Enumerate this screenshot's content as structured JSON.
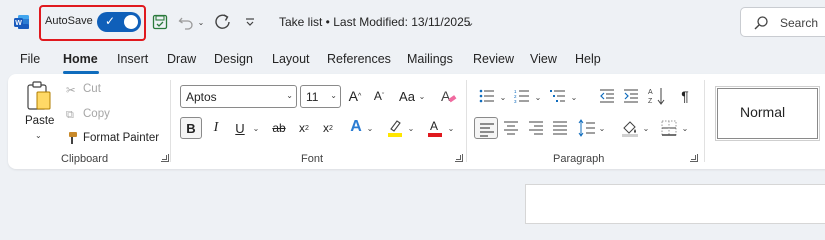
{
  "titlebar": {
    "autosave_label": "AutoSave",
    "autosave_on": true,
    "doc_title": "Take list • Last Modified: 13/11/2025",
    "search_label": "Search"
  },
  "tabs": [
    "File",
    "Home",
    "Insert",
    "Draw",
    "Design",
    "Layout",
    "References",
    "Mailings",
    "Review",
    "View",
    "Help"
  ],
  "active_tab": "Home",
  "clipboard": {
    "paste": "Paste",
    "cut": "Cut",
    "copy": "Copy",
    "format_painter": "Format Painter",
    "group_label": "Clipboard"
  },
  "font": {
    "font_name": "Aptos",
    "font_size": "11",
    "group_label": "Font",
    "case_label": "Aa"
  },
  "paragraph": {
    "group_label": "Paragraph"
  },
  "styles": {
    "normal": "Normal"
  },
  "colors": {
    "accent": "#0f6cbd",
    "toggle": "#0f5fb9",
    "highlight": "#ffe600",
    "font_color": "#e0191e",
    "annotation": "#e0191e"
  }
}
